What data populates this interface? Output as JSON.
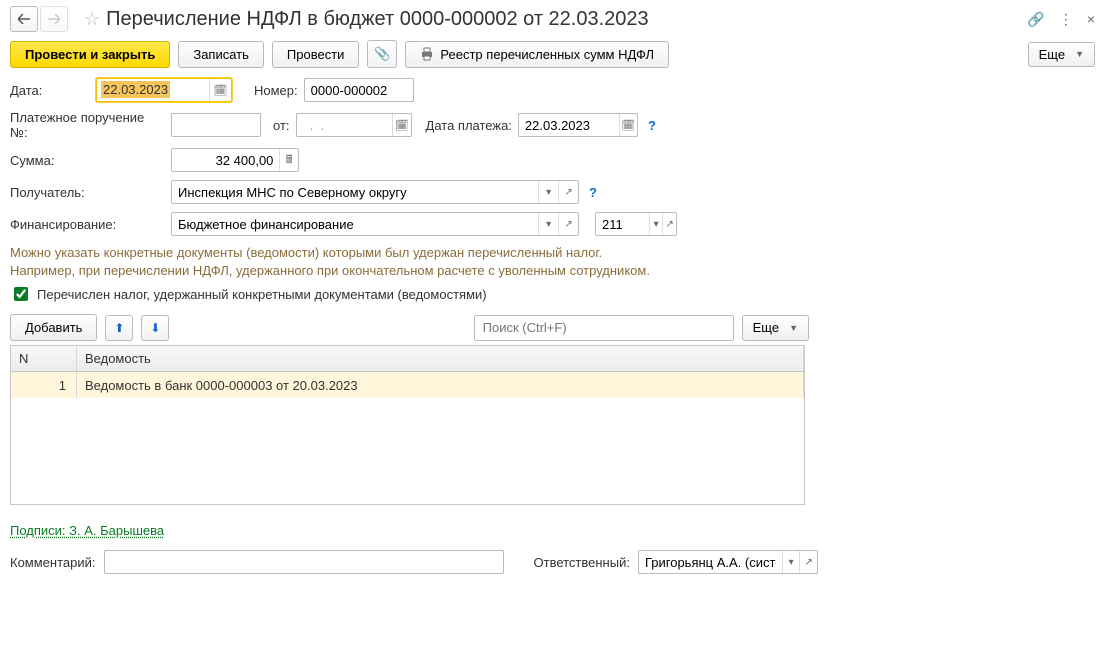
{
  "header": {
    "title": "Перечисление НДФЛ в бюджет 0000-000002 от 22.03.2023"
  },
  "toolbar": {
    "save_close": "Провести и закрыть",
    "save": "Записать",
    "post": "Провести",
    "registry": "Реестр перечисленных сумм НДФЛ",
    "more": "Еще"
  },
  "form": {
    "date_label": "Дата:",
    "date_value": "22.03.2023",
    "number_label": "Номер:",
    "number_value": "0000-000002",
    "payment_order_label": "Платежное поручение №:",
    "payment_order_value": "",
    "from_label": "от:",
    "from_value": "  .  .    ",
    "payment_date_label": "Дата платежа:",
    "payment_date_value": "22.03.2023",
    "amount_label": "Сумма:",
    "amount_value": "32 400,00",
    "recipient_label": "Получатель:",
    "recipient_value": "Инспекция МНС по Северному округу",
    "financing_label": "Финансирование:",
    "financing_value": "Бюджетное финансирование",
    "kosgu_value": "211"
  },
  "hint": {
    "line1": "Можно указать конкретные документы (ведомости) которыми был удержан перечисленный налог.",
    "line2": "Например, при перечислении НДФЛ, удержанного при окончательном расчете с уволенным сотрудником."
  },
  "checkbox": {
    "label": "Перечислен налог, удержанный конкретными документами (ведомостями)"
  },
  "subtoolbar": {
    "add": "Добавить",
    "search_placeholder": "Поиск (Ctrl+F)",
    "more": "Еще"
  },
  "table": {
    "col_n": "N",
    "col_v": "Ведомость",
    "rows": [
      {
        "n": "1",
        "v": "Ведомость в банк 0000-000003 от 20.03.2023"
      }
    ]
  },
  "signatures": "Подписи: З. А. Барышева",
  "bottom": {
    "comment_label": "Комментарий:",
    "comment_value": "",
    "responsible_label": "Ответственный:",
    "responsible_value": "Григорьянц А.А. (системн"
  }
}
